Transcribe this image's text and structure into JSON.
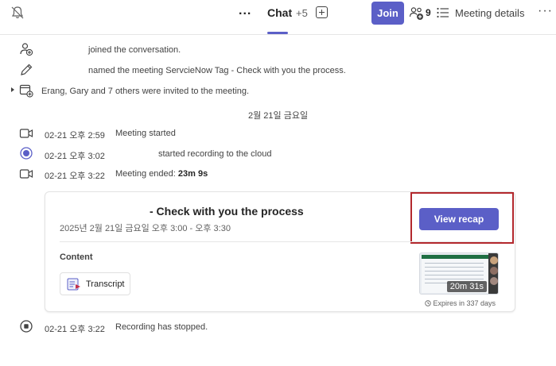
{
  "topbar": {
    "ellipsis": "...",
    "chat_tab": "Chat",
    "plus_count": "+5",
    "join_label": "Join",
    "people_count": "9",
    "meeting_details": "Meeting details",
    "more": "···"
  },
  "activity": [
    {
      "text": "joined the conversation.",
      "icon": "person-add-icon"
    },
    {
      "text": "named the meeting ServcieNow Tag - Check with you the process.",
      "icon": "pencil-icon"
    },
    {
      "text": "Erang, Gary and 7 others were invited to the meeting.",
      "icon": "calendar-add-icon"
    }
  ],
  "date_separator": "2월 21일 금요일",
  "events": [
    {
      "time": "02-21 오후 2:59",
      "text": "Meeting started",
      "icon": "video-icon"
    },
    {
      "time": "02-21 오후 3:02",
      "text": "started recording to the cloud",
      "icon": "recording-icon"
    },
    {
      "time": "02-21 오후 3:22",
      "text": "Meeting ended: ",
      "bold": "23m 9s",
      "icon": "video-icon"
    }
  ],
  "card": {
    "title": "- Check with you the process",
    "time": "2025년 2월 21일 금요일 오후 3:00 - 오후 3:30",
    "view_recap": "View recap",
    "content_label": "Content",
    "transcript_label": "Transcript",
    "duration": "20m 31s",
    "expires": "Expires in 337 days"
  },
  "final_event": {
    "time": "02-21 오후 3:22",
    "text": "Recording has stopped.",
    "icon": "stop-icon"
  },
  "colors": {
    "accent": "#5b5fc7",
    "highlight": "#b3282d"
  }
}
